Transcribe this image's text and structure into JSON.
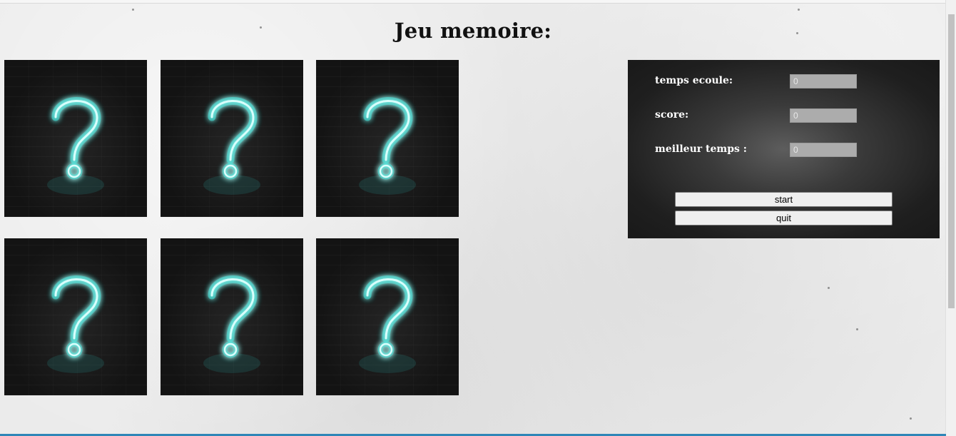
{
  "page": {
    "title": "Jeu memoire:"
  },
  "cards": [
    {
      "icon": "question-mark-icon",
      "state": "face-down"
    },
    {
      "icon": "question-mark-icon",
      "state": "face-down"
    },
    {
      "icon": "question-mark-icon",
      "state": "face-down"
    },
    {
      "icon": "question-mark-icon",
      "state": "face-down"
    },
    {
      "icon": "question-mark-icon",
      "state": "face-down"
    },
    {
      "icon": "question-mark-icon",
      "state": "face-down"
    }
  ],
  "panel": {
    "elapsed_label": "temps ecoule:",
    "elapsed_value": "0",
    "score_label": "score:",
    "score_value": "0",
    "best_label": "meilleur temps :",
    "best_value": "0",
    "start_label": "start",
    "quit_label": "quit"
  },
  "colors": {
    "neon": "#33e6dc",
    "card_bg": "#141414",
    "panel_bg": "#1f1f1f",
    "field_bg": "#acacac",
    "accent_bottom": "#2f86b7"
  }
}
